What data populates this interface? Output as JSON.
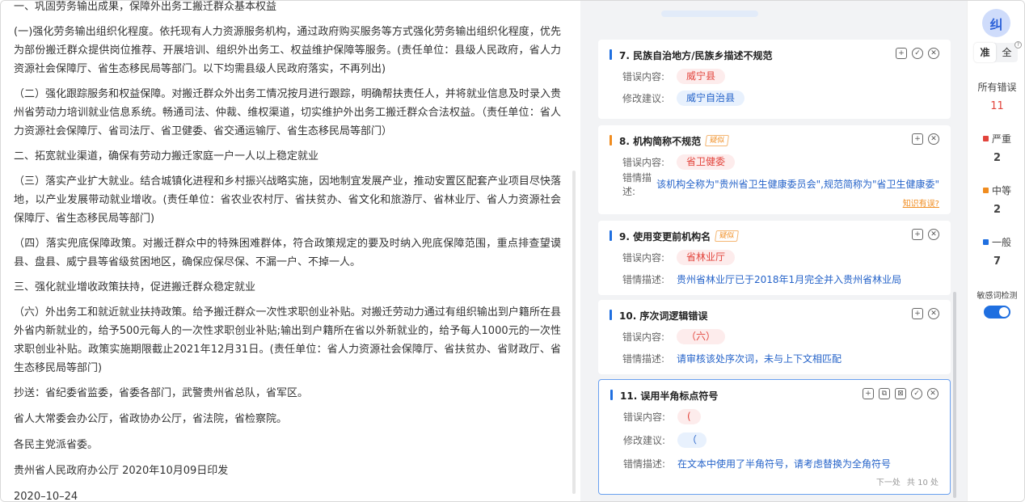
{
  "document": {
    "paragraphs": [
      "一、巩固劳务输出成果，保障外出务工搬迁群众基本权益",
      "(一)强化劳务输出组织化程度。依托现有人力资源服务机构，通过政府购买服务等方式强化劳务输出组织化程度，优先为部份搬迁群众提供岗位推荐、开展培训、组织外出务工、权益维护保障等服务。(责任单位：县级人民政府，省人力资源社会保障厅、省生态移民局等部门。以下均需县级人民政府落实，不再列出)",
      "（二）强化跟踪服务和权益保障。对搬迁群众外出务工情况按月进行跟踪，明确帮扶责任人，并将就业信息及时录入贵州省劳动力培训就业信息系统。畅通司法、仲裁、维权渠道，切实维护外出务工搬迁群众合法权益。（责任单位：省人力资源社会保障厅、省司法厅、省卫健委、省交通运输厅、省生态移民局等部门）",
      "二、拓宽就业渠道，确保有劳动力搬迁家庭一户一人以上稳定就业",
      "（三）落实产业扩大就业。结合城镇化进程和乡村振兴战略实施，因地制宜发展产业，推动安置区配套产业项目尽快落地，以产业发展带动就业增收。(责任单位：省农业农村厅、省扶贫办、省文化和旅游厅、省林业厅、省人力资源社会保障厅、省生态移民局等部门)",
      "（四）落实兜底保障政策。对搬迁群众中的特殊困难群体，符合政策规定的要及时纳入兜底保障范围，重点排查望谟县、盘县、威宁县等省级贫困地区，确保应保尽保、不漏一户、不掉一人。",
      "三、强化就业增收政策扶持，促进搬迁群众稳定就业",
      "（六）外出务工和就近就业扶持政策。给予搬迁群众一次性求职创业补贴。对搬迁劳动力通过有组织输出到户籍所在县外省内新就业的，给予500元每人的一次性求职创业补贴;输出到户籍所在省以外新就业的，给予每人1000元的一次性求职创业补贴。政策实施期限截止2021年12月31日。(责任单位：省人力资源社会保障厅、省扶贫办、省财政厅、省生态移民局等部门)",
      "抄送：省纪委省监委，省委各部门，武警贵州省总队，省军区。",
      "省人大常委会办公厅，省政协办公厅，省法院，省检察院。",
      "各民主党派省委。",
      "贵州省人民政府办公厅 2020年10月09日印发",
      "2020–10–24"
    ]
  },
  "labels": {
    "content": "错误内容:",
    "suggestion": "修改建议:",
    "description": "错情描述:",
    "doubt_tag": "疑似",
    "knowledge": "知识有误?",
    "next": "下一处",
    "total": "共 10 处"
  },
  "cards": [
    {
      "title": "7. 民族自治地方/民族乡描述不规范",
      "content": "威宁县",
      "suggestion": "威宁自治县"
    },
    {
      "title": "8. 机构简称不规范",
      "content": "省卫健委",
      "description": "该机构全称为\"贵州省卫生健康委员会\",规范简称为\"省卫生健康委\""
    },
    {
      "title": "9. 使用变更前机构名",
      "content": "省林业厅",
      "description": "贵州省林业厅已于2018年1月完全并入贵州省林业局"
    },
    {
      "title": "10. 序次词逻辑错误",
      "content": "（六）",
      "description": "请审核该处序次词，未与上下文相匹配"
    },
    {
      "title": "11. 误用半角标点符号",
      "content": "(",
      "suggestion": "（",
      "description": "在文本中使用了半角符号，请考虑替换为全角符号"
    }
  ],
  "sidebar": {
    "avatar": "纠",
    "tab_zhun": "准",
    "tab_quan": "全",
    "all_errors_label": "所有错误",
    "all_errors_count": "11",
    "severe_label": "严重",
    "severe_count": "2",
    "medium_label": "中等",
    "medium_count": "2",
    "general_label": "一般",
    "general_count": "7",
    "sensitive_label": "敏感词检测",
    "sensitive_on": true
  },
  "colors": {
    "severe": "#e2443c",
    "medium": "#f08c1f",
    "general": "#1f6fe0",
    "accent": "#1f6fe0"
  }
}
